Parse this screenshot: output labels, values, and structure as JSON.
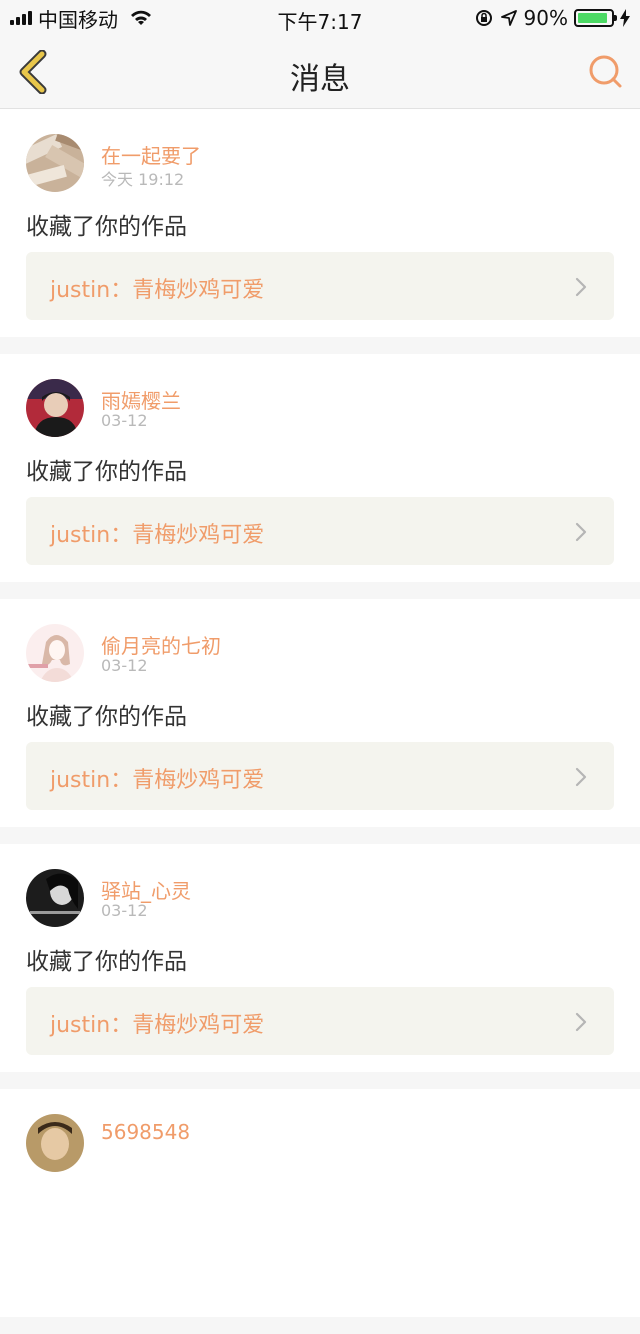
{
  "status_bar": {
    "carrier": "中国移动",
    "time": "下午7:17",
    "battery_percent": "90%",
    "battery_level": 0.9,
    "icons": [
      "signal-icon",
      "wifi-icon",
      "orientation-lock-icon",
      "location-icon",
      "battery-icon",
      "charging-icon"
    ]
  },
  "nav": {
    "title": "消息",
    "back_icon": "chevron-left-icon",
    "search_icon": "search-icon"
  },
  "colors": {
    "accent": "#f09c6a",
    "back_icon": "#e8c64a",
    "work_box_bg": "#f4f4ee"
  },
  "messages": [
    {
      "username": "在一起要了",
      "time": "今天 19:12",
      "action": "收藏了你的作品",
      "work": "justin：青梅炒鸡可爱"
    },
    {
      "username": "雨嫣樱兰",
      "time": "03-12",
      "action": "收藏了你的作品",
      "work": "justin：青梅炒鸡可爱"
    },
    {
      "username": "偷月亮的七初",
      "time": "03-12",
      "action": "收藏了你的作品",
      "work": "justin：青梅炒鸡可爱"
    },
    {
      "username": "驿站_心灵",
      "time": "03-12",
      "action": "收藏了你的作品",
      "work": "justin：青梅炒鸡可爱"
    },
    {
      "username": "5698548",
      "time": "",
      "action": "",
      "work": ""
    }
  ]
}
